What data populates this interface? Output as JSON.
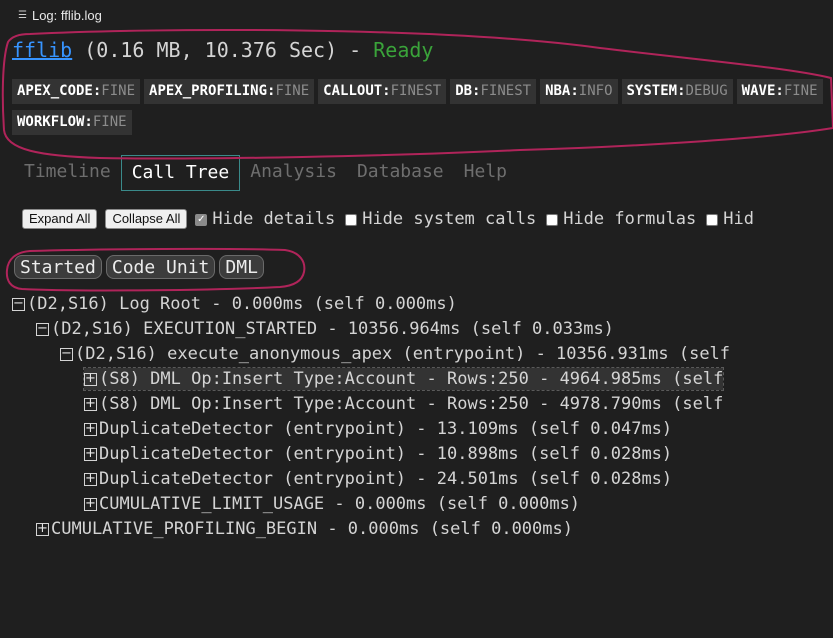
{
  "window": {
    "title": "Log: fflib.log"
  },
  "header": {
    "log_name": "fflib",
    "details": " (0.16 MB, 10.376 Sec) - ",
    "status": "Ready"
  },
  "levels": [
    {
      "name": "APEX_CODE:",
      "value": "FINE"
    },
    {
      "name": "APEX_PROFILING:",
      "value": "FINE"
    },
    {
      "name": "CALLOUT:",
      "value": "FINEST"
    },
    {
      "name": "DB:",
      "value": "FINEST"
    },
    {
      "name": "NBA:",
      "value": "INFO"
    },
    {
      "name": "SYSTEM:",
      "value": "DEBUG"
    },
    {
      "name": "WAVE:",
      "value": "FINE"
    },
    {
      "name": "WORKFLOW:",
      "value": "FINE"
    }
  ],
  "tabs": [
    "Timeline",
    "Call Tree",
    "Analysis",
    "Database",
    "Help"
  ],
  "active_tab": "Call Tree",
  "controls": {
    "expand_all": "Expand All",
    "collapse_all": "Collapse All",
    "hide_details": "Hide details",
    "hide_system_calls": "Hide system calls",
    "hide_formulas": "Hide formulas",
    "hide_more": "Hid"
  },
  "filters": [
    "Started",
    "Code Unit",
    "DML"
  ],
  "tree": [
    {
      "text": "(D2,S16) Log Root - 0.000ms (self 0.000ms)",
      "toggle": "−",
      "selected": false
    },
    {
      "text": "(D2,S16) EXECUTION_STARTED - 10356.964ms (self 0.033ms)",
      "toggle": "−",
      "selected": false
    },
    {
      "text": "(D2,S16) execute_anonymous_apex (entrypoint) - 10356.931ms (self",
      "toggle": "−",
      "selected": false
    },
    {
      "text": "(S8) DML Op:Insert Type:Account - Rows:250 - 4964.985ms (self",
      "toggle": "+",
      "selected": true
    },
    {
      "text": "(S8) DML Op:Insert Type:Account - Rows:250 - 4978.790ms (self",
      "toggle": "+",
      "selected": false
    },
    {
      "text": "DuplicateDetector (entrypoint) - 13.109ms (self 0.047ms)",
      "toggle": "+",
      "selected": false
    },
    {
      "text": "DuplicateDetector (entrypoint) - 10.898ms (self 0.028ms)",
      "toggle": "+",
      "selected": false
    },
    {
      "text": "DuplicateDetector (entrypoint) - 24.501ms (self 0.028ms)",
      "toggle": "+",
      "selected": false
    },
    {
      "text": "CUMULATIVE_LIMIT_USAGE - 0.000ms (self 0.000ms)",
      "toggle": "+",
      "selected": false
    },
    {
      "text": "CUMULATIVE_PROFILING_BEGIN - 0.000ms (self 0.000ms)",
      "toggle": "+",
      "selected": false
    }
  ],
  "colors": {
    "annotation": "#b0245a",
    "link": "#3794ff",
    "ready": "#3aa33a"
  }
}
